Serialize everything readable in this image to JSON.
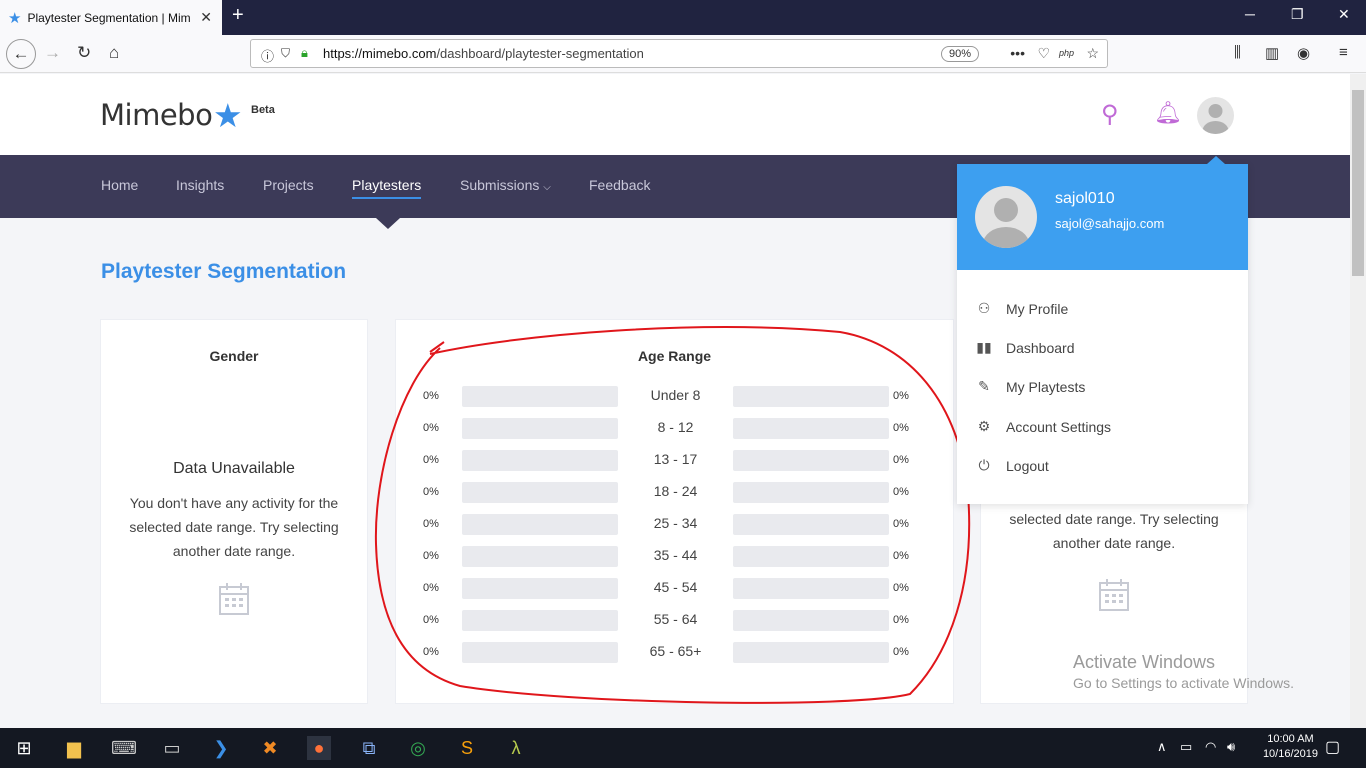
{
  "browser": {
    "tab_title": "Playtester Segmentation | Mim",
    "url_domain": "https://mimebo.com",
    "url_path": "/dashboard/playtester-segmentation",
    "zoom": "90%",
    "php_label": "php"
  },
  "header": {
    "logo": "Mimebo",
    "beta": "Beta"
  },
  "menu": {
    "items": [
      "Home",
      "Insights",
      "Projects",
      "Playtesters",
      "Submissions",
      "Feedback"
    ],
    "active": "Playtesters"
  },
  "page": {
    "title": "Playtester Segmentation"
  },
  "gender_card": {
    "title": "Gender",
    "unavailable": "Data Unavailable",
    "message": "You don't have any activity for the selected date range. Try selecting another date range."
  },
  "age_card": {
    "title": "Age Range",
    "rows": [
      {
        "label": "Under 8",
        "left": "0%",
        "right": "0%"
      },
      {
        "label": "8 - 12",
        "left": "0%",
        "right": "0%"
      },
      {
        "label": "13 - 17",
        "left": "0%",
        "right": "0%"
      },
      {
        "label": "18 - 24",
        "left": "0%",
        "right": "0%"
      },
      {
        "label": "25 - 34",
        "left": "0%",
        "right": "0%"
      },
      {
        "label": "35 - 44",
        "left": "0%",
        "right": "0%"
      },
      {
        "label": "45 - 54",
        "left": "0%",
        "right": "0%"
      },
      {
        "label": "55 - 64",
        "left": "0%",
        "right": "0%"
      },
      {
        "label": "65 - 65+",
        "left": "0%",
        "right": "0%"
      }
    ]
  },
  "third_card": {
    "message": "selected date range. Try selecting another date range."
  },
  "profile_menu": {
    "username": "sajol010",
    "email": "sajol@sahajjo.com",
    "items": [
      {
        "label": "My Profile",
        "icon": "user-icon"
      },
      {
        "label": "Dashboard",
        "icon": "bar-chart-icon"
      },
      {
        "label": "My Playtests",
        "icon": "pencil-icon"
      },
      {
        "label": "Account Settings",
        "icon": "gear-icon"
      },
      {
        "label": "Logout",
        "icon": "power-icon"
      }
    ]
  },
  "watermark": {
    "line1": "Activate Windows",
    "line2": "Go to Settings to activate Windows."
  },
  "taskbar": {
    "time": "10:00 AM",
    "date": "10/16/2019"
  },
  "colors": {
    "accent": "#3b8fe6",
    "menubar": "#3c3a58",
    "dropdown_header": "#3d9ff0"
  }
}
